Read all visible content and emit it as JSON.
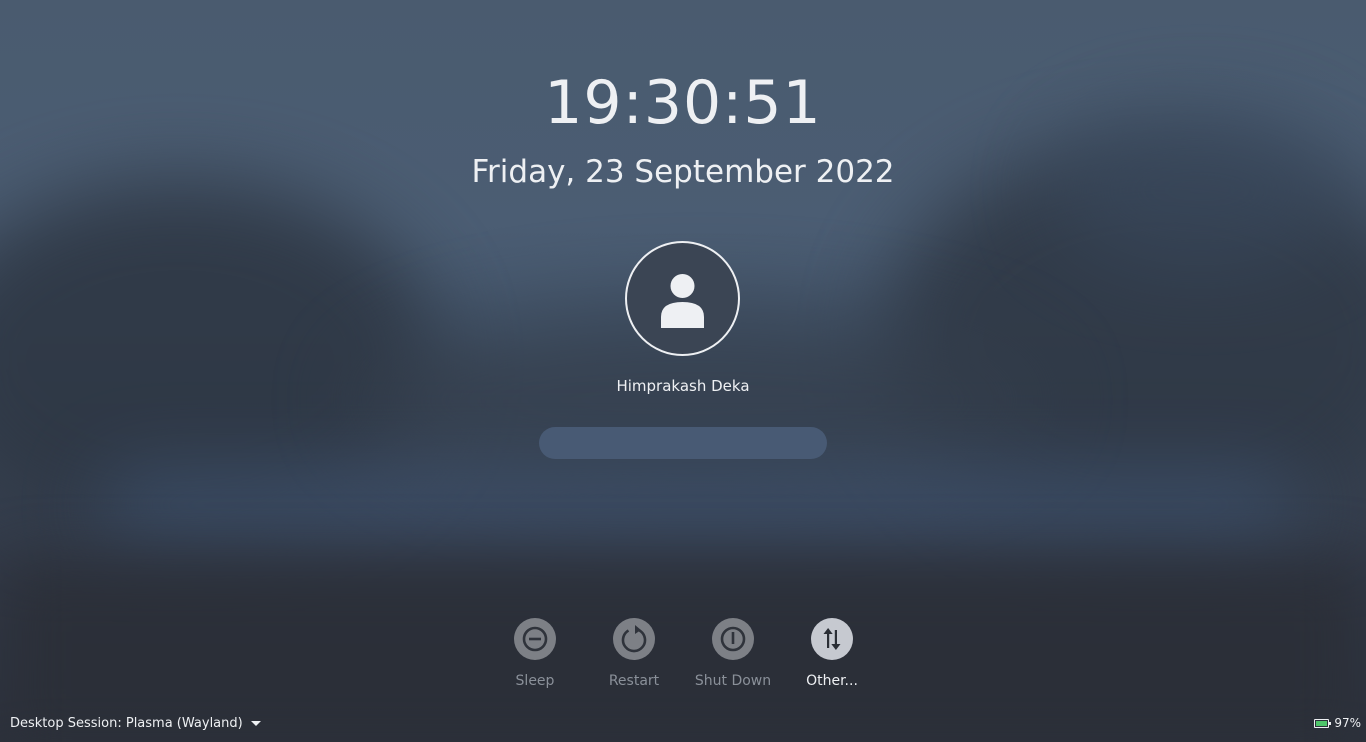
{
  "lockscreen": {
    "time": "19:30:51",
    "date": "Friday, 23 September 2022",
    "user": {
      "name": "Himprakash Deka",
      "avatar_icon": "user-icon"
    },
    "password": {
      "value": "",
      "placeholder": ""
    }
  },
  "actions": [
    {
      "label": "Sleep",
      "icon": "sleep-icon"
    },
    {
      "label": "Restart",
      "icon": "restart-icon"
    },
    {
      "label": "Shut Down",
      "icon": "shutdown-icon"
    },
    {
      "label": "Other...",
      "icon": "switch-user-icon"
    }
  ],
  "footer": {
    "session_label": "Desktop Session: Plasma (Wayland)",
    "battery_percent": "97%",
    "battery_level": 0.97
  },
  "colors": {
    "text": "#eef0f3",
    "dim_text": "#8a9099",
    "field_bg": "#485a74",
    "battery_green": "#4ec56a"
  }
}
